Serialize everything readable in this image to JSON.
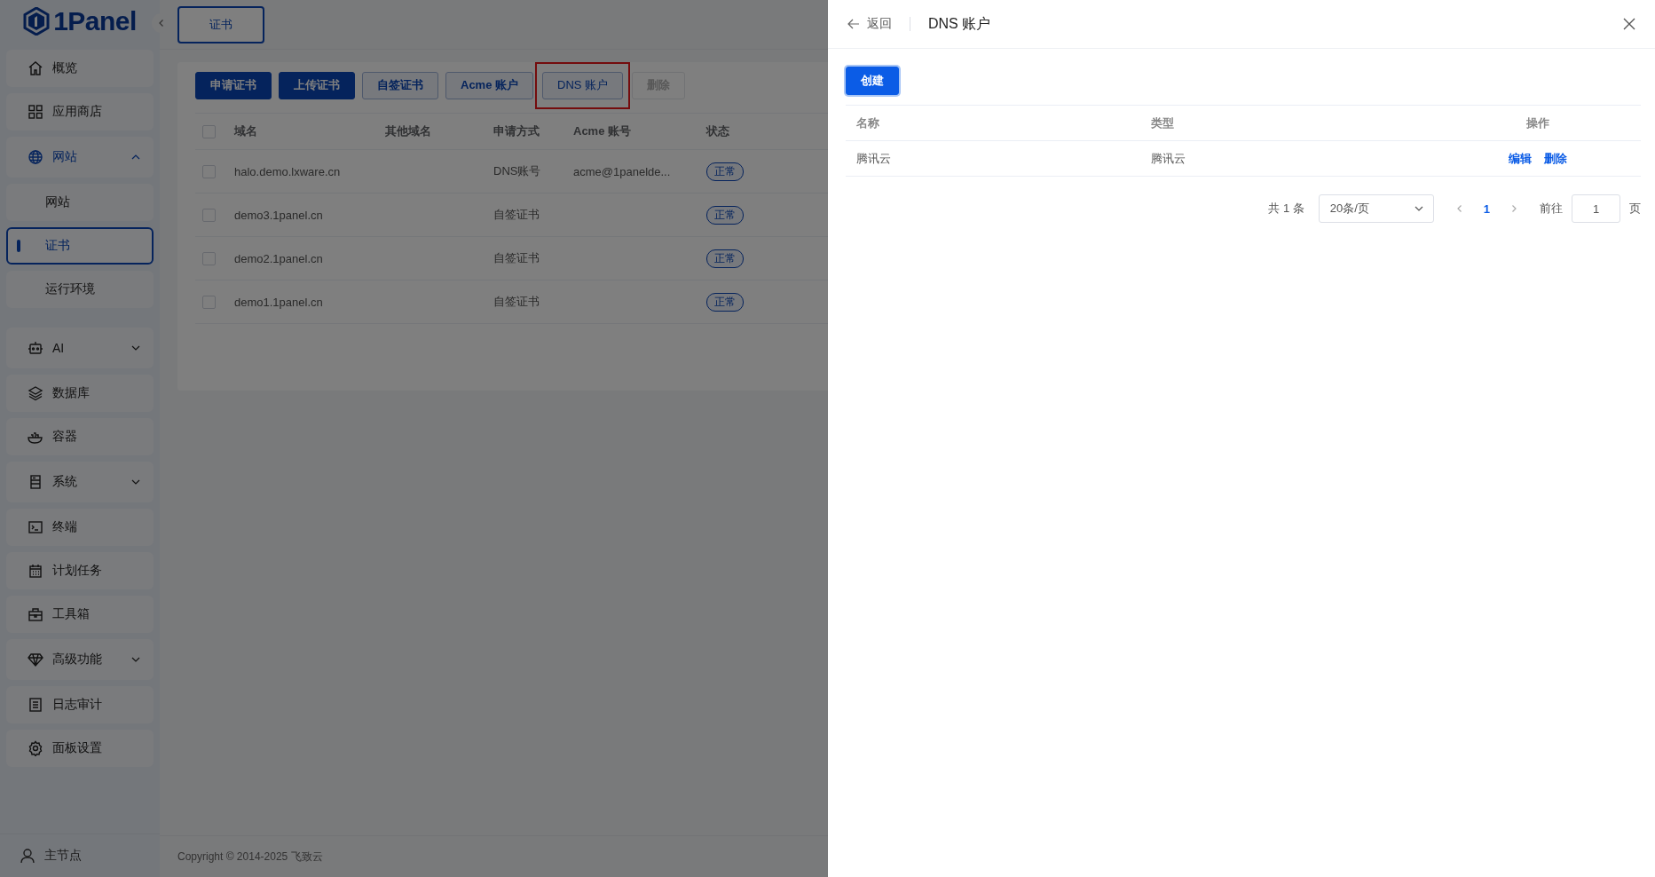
{
  "sidebar": {
    "logo": "1Panel",
    "items": [
      {
        "label": "概览",
        "kind": "link",
        "selected": false
      },
      {
        "label": "应用商店",
        "kind": "link",
        "selected": false
      },
      {
        "label": "网站",
        "kind": "group",
        "selected": true,
        "expanded": true,
        "children": [
          {
            "label": "网站",
            "selected": false
          },
          {
            "label": "证书",
            "selected": true
          },
          {
            "label": "运行环境",
            "selected": false
          }
        ]
      },
      {
        "label": "AI",
        "kind": "group",
        "selected": false,
        "expanded": false
      },
      {
        "label": "数据库",
        "kind": "link",
        "selected": false
      },
      {
        "label": "容器",
        "kind": "link",
        "selected": false
      },
      {
        "label": "系统",
        "kind": "group",
        "selected": false,
        "expanded": false
      },
      {
        "label": "终端",
        "kind": "link",
        "selected": false
      },
      {
        "label": "计划任务",
        "kind": "link",
        "selected": false
      },
      {
        "label": "工具箱",
        "kind": "link",
        "selected": false
      },
      {
        "label": "高级功能",
        "kind": "group",
        "selected": false,
        "expanded": false
      },
      {
        "label": "日志审计",
        "kind": "link",
        "selected": false
      },
      {
        "label": "面板设置",
        "kind": "link",
        "selected": false
      }
    ],
    "node": "主节点"
  },
  "tabs": [
    {
      "label": "证书",
      "selected": true
    }
  ],
  "toolbar": [
    {
      "label": "申请证书",
      "kind": "primary",
      "disabled": false,
      "highlighted": false
    },
    {
      "label": "上传证书",
      "kind": "primary",
      "disabled": false,
      "highlighted": false
    },
    {
      "label": "自签证书",
      "kind": "plain",
      "disabled": false,
      "highlighted": false
    },
    {
      "label": "Acme 账户",
      "kind": "plain",
      "disabled": false,
      "highlighted": false
    },
    {
      "label": "DNS 账户",
      "kind": "plain",
      "disabled": false,
      "highlighted": true
    },
    {
      "label": "删除",
      "kind": "plain",
      "disabled": true,
      "highlighted": false
    }
  ],
  "table": {
    "select_all_checked": false,
    "columns": [
      "域名",
      "其他域名",
      "申请方式",
      "Acme 账号",
      "状态"
    ],
    "rows": [
      {
        "checked": false,
        "domain": "halo.demo.lxware.cn",
        "method": "DNS账号",
        "acme_account": "acme@1panelde...",
        "status": "正常"
      },
      {
        "checked": false,
        "domain": "demo3.1panel.cn",
        "method": "自签证书",
        "status": "正常"
      },
      {
        "checked": false,
        "domain": "demo2.1panel.cn",
        "method": "自签证书",
        "status": "正常"
      },
      {
        "checked": false,
        "domain": "demo1.1panel.cn",
        "method": "自签证书",
        "status": "正常"
      }
    ]
  },
  "footer": "Copyright © 2014-2025 飞致云",
  "drawer": {
    "back": "返回",
    "title": "DNS 账户",
    "create": "创建",
    "columns": [
      "名称",
      "类型",
      "操作"
    ],
    "rows": [
      {
        "name": "腾讯云",
        "type": "腾讯云",
        "actions": [
          "编辑",
          "删除"
        ]
      }
    ],
    "pagination": {
      "total": "共 1 条",
      "page_size": "20条/页",
      "pages": [
        {
          "label": "1",
          "selected": true
        }
      ],
      "goto_label": "前往",
      "goto_value": "1",
      "page_unit": "页"
    }
  }
}
